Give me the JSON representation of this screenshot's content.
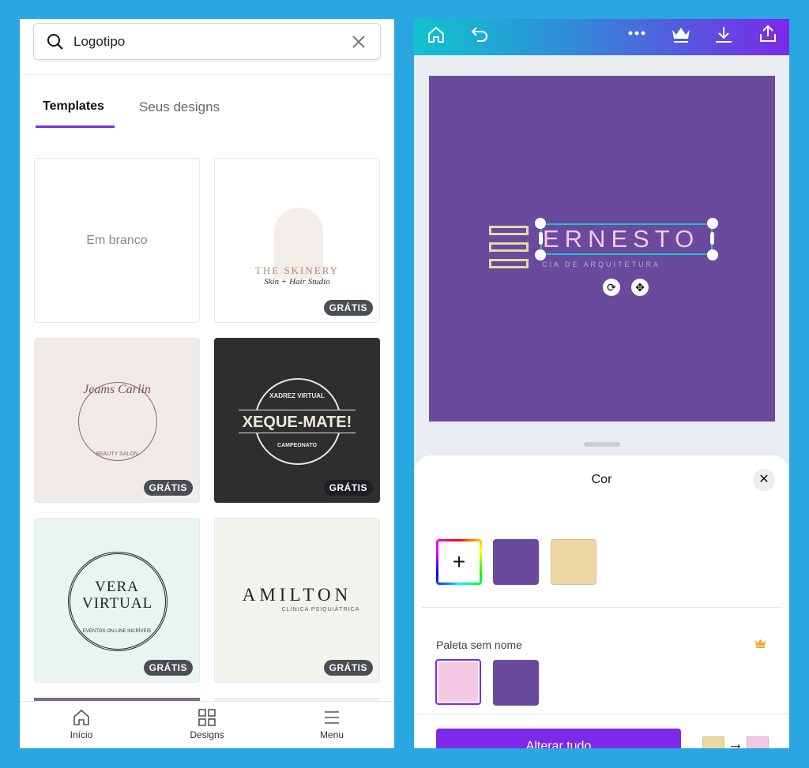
{
  "search": {
    "value": "Logotipo"
  },
  "tabs": [
    {
      "label": "Templates",
      "active": true
    },
    {
      "label": "Seus designs",
      "active": false
    }
  ],
  "templates": [
    {
      "label": "Em branco"
    },
    {
      "title": "THE SKINERY",
      "subtitle": "Skin + Hair Studio",
      "badge": "GRÁTIS"
    },
    {
      "title": "Jeams Carlin",
      "subtitle": "BEAUTY SALON",
      "badge": "GRÁTIS"
    },
    {
      "title": "XEQUE-MATE!",
      "top": "XADREZ VIRTUAL",
      "bottom": "CAMPEONATO",
      "badge": "GRÁTIS"
    },
    {
      "title": "VERA VIRTUAL",
      "subtitle": "EVENTOS ON-LINE INCRÍVEIS",
      "badge": "GRÁTIS"
    },
    {
      "title": "AMILTON",
      "subtitle": "CLÍNICA PSIQUIÁTRICA",
      "badge": "GRÁTIS"
    }
  ],
  "bottom_nav": [
    {
      "label": "Início",
      "icon": "home-icon"
    },
    {
      "label": "Designs",
      "icon": "grid-icon"
    },
    {
      "label": "Menu",
      "icon": "hamburger-icon"
    }
  ],
  "toolbar": {
    "icons": [
      "home-icon",
      "undo-icon",
      "more-icon",
      "crown-icon",
      "download-icon",
      "share-icon"
    ]
  },
  "design": {
    "title": "ERNESTO",
    "subtitle": "CIA DE ARQUITETURA",
    "background": "#694a9c",
    "text_color": "#f0c8e4",
    "accent": "#ecd7a5"
  },
  "color_panel": {
    "title": "Cor",
    "document_colors": [
      "#694a9c",
      "#ecd7a5"
    ],
    "palette_name": "Paleta sem nome",
    "palette_colors": [
      "#f2c8e4",
      "#694a9c"
    ],
    "selected": "#f2c8e4",
    "apply_all_label": "Alterar tudo",
    "replace_from": "#ecd7a5",
    "replace_to": "#f2c8e4",
    "accent": "#7d2ae8"
  }
}
